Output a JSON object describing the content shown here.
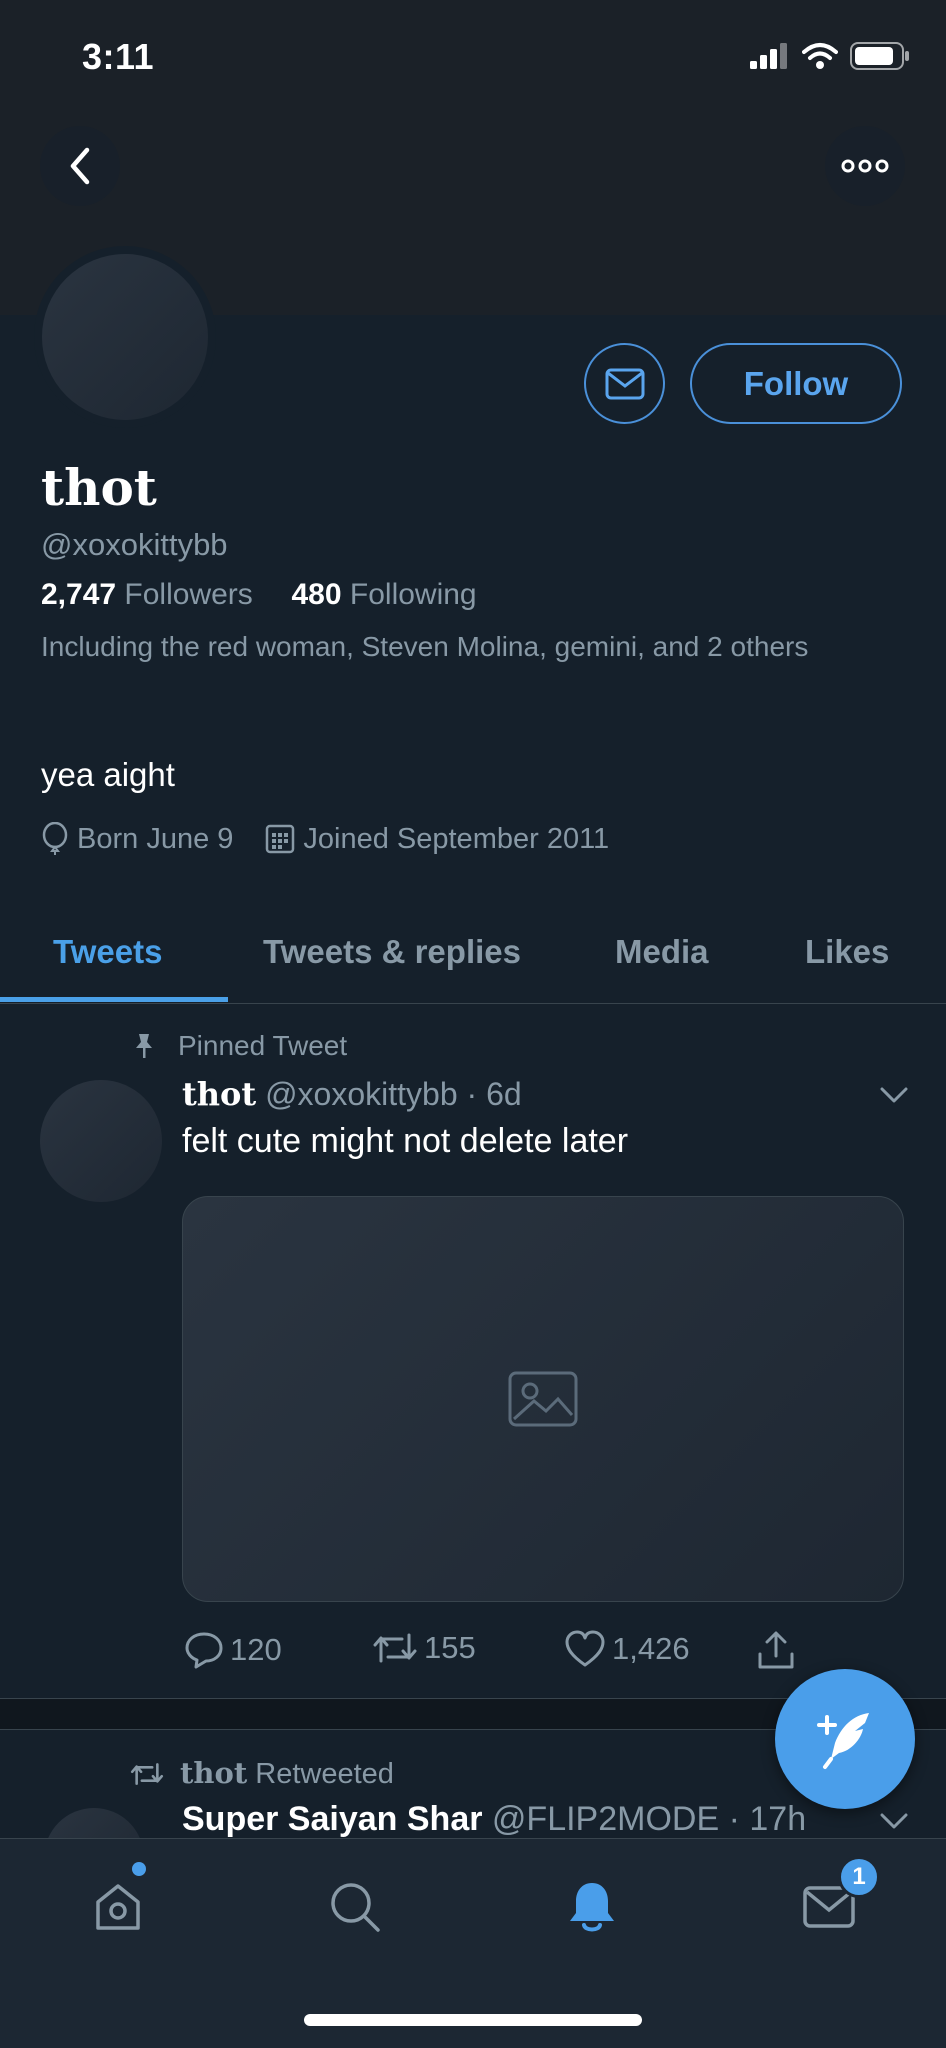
{
  "status_bar": {
    "time": "3:11"
  },
  "profile": {
    "display_name": "thot",
    "handle": "@xoxokittybb",
    "followers_count": "2,747",
    "followers_label": "Followers",
    "following_count": "480",
    "following_label": "Following",
    "followed_by": "Including the red woman, Steven Molina, gemini, and 2 others",
    "bio": "yea aight",
    "birthday": "Born June 9",
    "joined": "Joined September 2011",
    "follow_label": "Follow"
  },
  "tabs": [
    {
      "label": "Tweets",
      "active": true
    },
    {
      "label": "Tweets & replies",
      "active": false
    },
    {
      "label": "Media",
      "active": false
    },
    {
      "label": "Likes",
      "active": false
    }
  ],
  "pinned_tweet": {
    "pinned_label": "Pinned Tweet",
    "author_name": "thot",
    "author_handle": "@xoxokittybb",
    "time": "· 6d",
    "text": "felt cute might not delete later",
    "replies": "120",
    "retweets": "155",
    "likes": "1,426"
  },
  "retweet": {
    "retweeter": "thot",
    "retweeted_label": "Retweeted",
    "author_name": "Super Saiyan Shar",
    "author_handle": "@FLIP2MODE",
    "time": "· 17h"
  },
  "nav": {
    "messages_badge": "1"
  },
  "colors": {
    "background": "#15202b",
    "accent": "#4a9eea",
    "muted": "#8899a6"
  }
}
